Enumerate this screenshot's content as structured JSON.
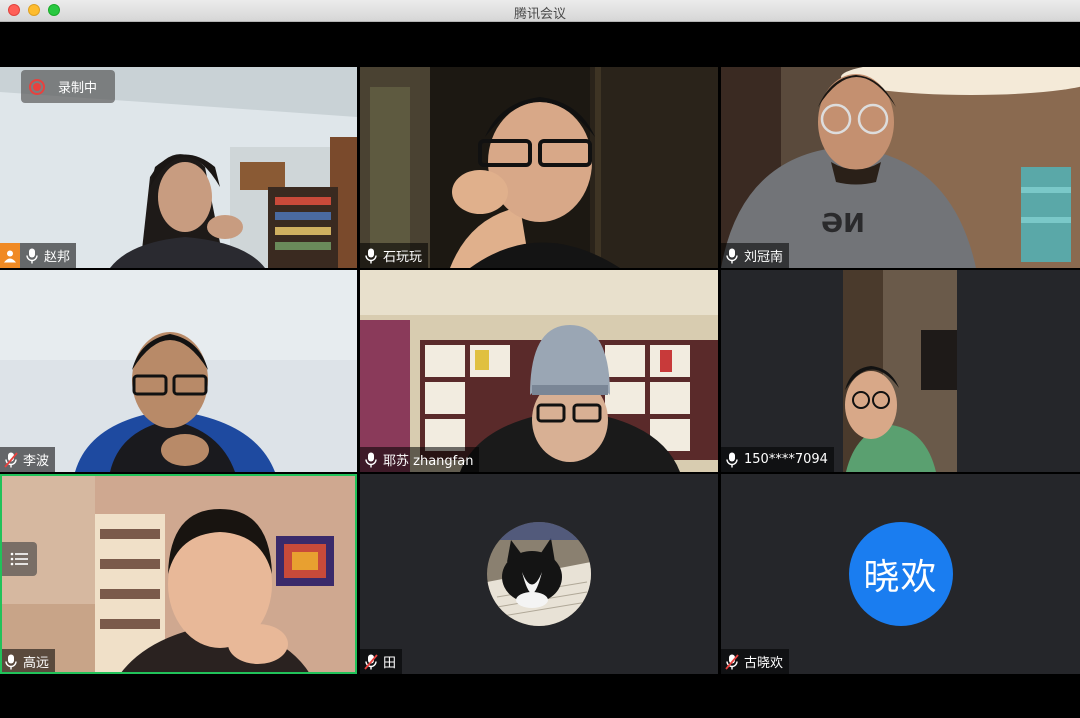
{
  "window": {
    "title": "腾讯会议"
  },
  "recording": {
    "label": "录制中"
  },
  "participants": [
    {
      "name": "赵邦",
      "mic": "on",
      "host": true
    },
    {
      "name": "石玩玩",
      "mic": "on"
    },
    {
      "name": "刘冠南",
      "mic": "on"
    },
    {
      "name": "李波",
      "mic": "muted"
    },
    {
      "name": "耶苏 zhangfan",
      "mic": "on"
    },
    {
      "name": "150****7094",
      "mic": "on"
    },
    {
      "name": "高远",
      "mic": "on",
      "speaking": true
    },
    {
      "name": "田",
      "mic": "muted",
      "avatar": "cat-photo"
    },
    {
      "name": "古晓欢",
      "mic": "muted",
      "avatar_text": "晓欢"
    }
  ],
  "icons": [
    "record-icon",
    "mic-icon",
    "mic-muted-icon",
    "host-icon",
    "list-menu-icon"
  ],
  "colors": {
    "speaking_border": "#21c25a",
    "record_red": "#e8413e",
    "avatar_blue": "#1a7df0",
    "host_orange": "#f08a24"
  }
}
